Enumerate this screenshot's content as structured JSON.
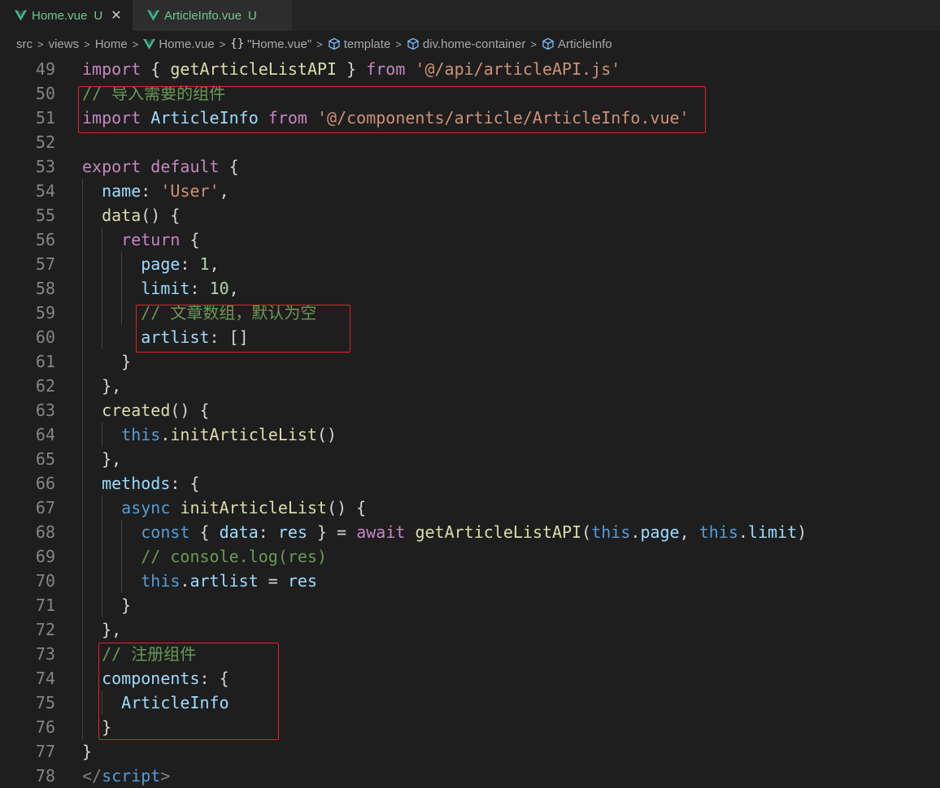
{
  "tabs": [
    {
      "label": "Home.vue",
      "badge": "U",
      "close": "✕",
      "active": true
    },
    {
      "label": "ArticleInfo.vue",
      "badge": "U",
      "active": false
    }
  ],
  "breadcrumb": {
    "items": [
      "src",
      "views",
      "Home",
      "Home.vue",
      "\"Home.vue\"",
      "template",
      "div.home-container",
      "ArticleInfo"
    ],
    "separator": ">",
    "braces": "{}"
  },
  "colors": {
    "keyword": "#c586c0",
    "storage": "#569cd6",
    "function": "#dcdcaa",
    "string": "#ce9178",
    "comment": "#6a9955",
    "variable": "#9cdcfe",
    "number": "#b5cea8",
    "highlight_box": "#e02424",
    "vue_green": "#41b883",
    "untracked": "#73c991"
  },
  "code": [
    {
      "n": "49",
      "t": [
        [
          "kw",
          "import"
        ],
        [
          "punc",
          " { "
        ],
        [
          "fn",
          "getArticleListAPI"
        ],
        [
          "punc",
          " } "
        ],
        [
          "kw",
          "from"
        ],
        [
          "punc",
          " "
        ],
        [
          "str",
          "'@/api/articleAPI.js'"
        ]
      ]
    },
    {
      "n": "50",
      "t": [
        [
          "cmt",
          "// 导入需要的组件"
        ]
      ]
    },
    {
      "n": "51",
      "t": [
        [
          "kw",
          "import"
        ],
        [
          "punc",
          " "
        ],
        [
          "cls",
          "ArticleInfo"
        ],
        [
          "punc",
          " "
        ],
        [
          "kw",
          "from"
        ],
        [
          "punc",
          " "
        ],
        [
          "str",
          "'@/components/article/ArticleInfo.vue'"
        ]
      ]
    },
    {
      "n": "52",
      "t": []
    },
    {
      "n": "53",
      "t": [
        [
          "kw",
          "export"
        ],
        [
          "punc",
          " "
        ],
        [
          "kw",
          "default"
        ],
        [
          "punc",
          " {"
        ]
      ]
    },
    {
      "n": "54",
      "t": [
        [
          "punc",
          "  "
        ],
        [
          "var",
          "name"
        ],
        [
          "punc",
          ": "
        ],
        [
          "str",
          "'User'"
        ],
        [
          "punc",
          ","
        ]
      ]
    },
    {
      "n": "55",
      "t": [
        [
          "punc",
          "  "
        ],
        [
          "fn",
          "data"
        ],
        [
          "punc",
          "() {"
        ]
      ]
    },
    {
      "n": "56",
      "t": [
        [
          "punc",
          "    "
        ],
        [
          "kw",
          "return"
        ],
        [
          "punc",
          " {"
        ]
      ]
    },
    {
      "n": "57",
      "t": [
        [
          "punc",
          "      "
        ],
        [
          "var",
          "page"
        ],
        [
          "punc",
          ": "
        ],
        [
          "num",
          "1"
        ],
        [
          "punc",
          ","
        ]
      ]
    },
    {
      "n": "58",
      "t": [
        [
          "punc",
          "      "
        ],
        [
          "var",
          "limit"
        ],
        [
          "punc",
          ": "
        ],
        [
          "num",
          "10"
        ],
        [
          "punc",
          ","
        ]
      ]
    },
    {
      "n": "59",
      "t": [
        [
          "punc",
          "      "
        ],
        [
          "cmt",
          "// 文章数组，默认为空"
        ]
      ]
    },
    {
      "n": "60",
      "t": [
        [
          "punc",
          "      "
        ],
        [
          "var",
          "artlist"
        ],
        [
          "punc",
          ": []"
        ]
      ]
    },
    {
      "n": "61",
      "t": [
        [
          "punc",
          "    }"
        ]
      ]
    },
    {
      "n": "62",
      "t": [
        [
          "punc",
          "  },"
        ]
      ]
    },
    {
      "n": "63",
      "t": [
        [
          "punc",
          "  "
        ],
        [
          "fn",
          "created"
        ],
        [
          "punc",
          "() {"
        ]
      ]
    },
    {
      "n": "64",
      "t": [
        [
          "punc",
          "    "
        ],
        [
          "kw2",
          "this"
        ],
        [
          "punc",
          "."
        ],
        [
          "fn",
          "initArticleList"
        ],
        [
          "punc",
          "()"
        ]
      ]
    },
    {
      "n": "65",
      "t": [
        [
          "punc",
          "  },"
        ]
      ]
    },
    {
      "n": "66",
      "t": [
        [
          "punc",
          "  "
        ],
        [
          "var",
          "methods"
        ],
        [
          "punc",
          ": {"
        ]
      ]
    },
    {
      "n": "67",
      "t": [
        [
          "punc",
          "    "
        ],
        [
          "kw2",
          "async"
        ],
        [
          "punc",
          " "
        ],
        [
          "fn",
          "initArticleList"
        ],
        [
          "punc",
          "() {"
        ]
      ]
    },
    {
      "n": "68",
      "t": [
        [
          "punc",
          "      "
        ],
        [
          "kw2",
          "const"
        ],
        [
          "punc",
          " { "
        ],
        [
          "var",
          "data"
        ],
        [
          "punc",
          ": "
        ],
        [
          "var",
          "res"
        ],
        [
          "punc",
          " } = "
        ],
        [
          "kw",
          "await"
        ],
        [
          "punc",
          " "
        ],
        [
          "fn",
          "getArticleListAPI"
        ],
        [
          "punc",
          "("
        ],
        [
          "kw2",
          "this"
        ],
        [
          "punc",
          "."
        ],
        [
          "var",
          "page"
        ],
        [
          "punc",
          ", "
        ],
        [
          "kw2",
          "this"
        ],
        [
          "punc",
          "."
        ],
        [
          "var",
          "limit"
        ],
        [
          "punc",
          ")"
        ]
      ]
    },
    {
      "n": "69",
      "t": [
        [
          "punc",
          "      "
        ],
        [
          "cmt",
          "// console.log(res)"
        ]
      ]
    },
    {
      "n": "70",
      "t": [
        [
          "punc",
          "      "
        ],
        [
          "kw2",
          "this"
        ],
        [
          "punc",
          "."
        ],
        [
          "var",
          "artlist"
        ],
        [
          "punc",
          " = "
        ],
        [
          "var",
          "res"
        ]
      ]
    },
    {
      "n": "71",
      "t": [
        [
          "punc",
          "    }"
        ]
      ]
    },
    {
      "n": "72",
      "t": [
        [
          "punc",
          "  },"
        ]
      ]
    },
    {
      "n": "73",
      "t": [
        [
          "punc",
          "  "
        ],
        [
          "cmt",
          "// 注册组件"
        ]
      ]
    },
    {
      "n": "74",
      "t": [
        [
          "punc",
          "  "
        ],
        [
          "var",
          "components"
        ],
        [
          "punc",
          ": {"
        ]
      ]
    },
    {
      "n": "75",
      "t": [
        [
          "punc",
          "    "
        ],
        [
          "cls",
          "ArticleInfo"
        ]
      ]
    },
    {
      "n": "76",
      "t": [
        [
          "punc",
          "  }"
        ]
      ]
    },
    {
      "n": "77",
      "t": [
        [
          "punc",
          "}"
        ]
      ]
    },
    {
      "n": "78",
      "t": [
        [
          "tag",
          "</"
        ],
        [
          "tagname",
          "script"
        ],
        [
          "tag",
          ">"
        ]
      ]
    }
  ]
}
